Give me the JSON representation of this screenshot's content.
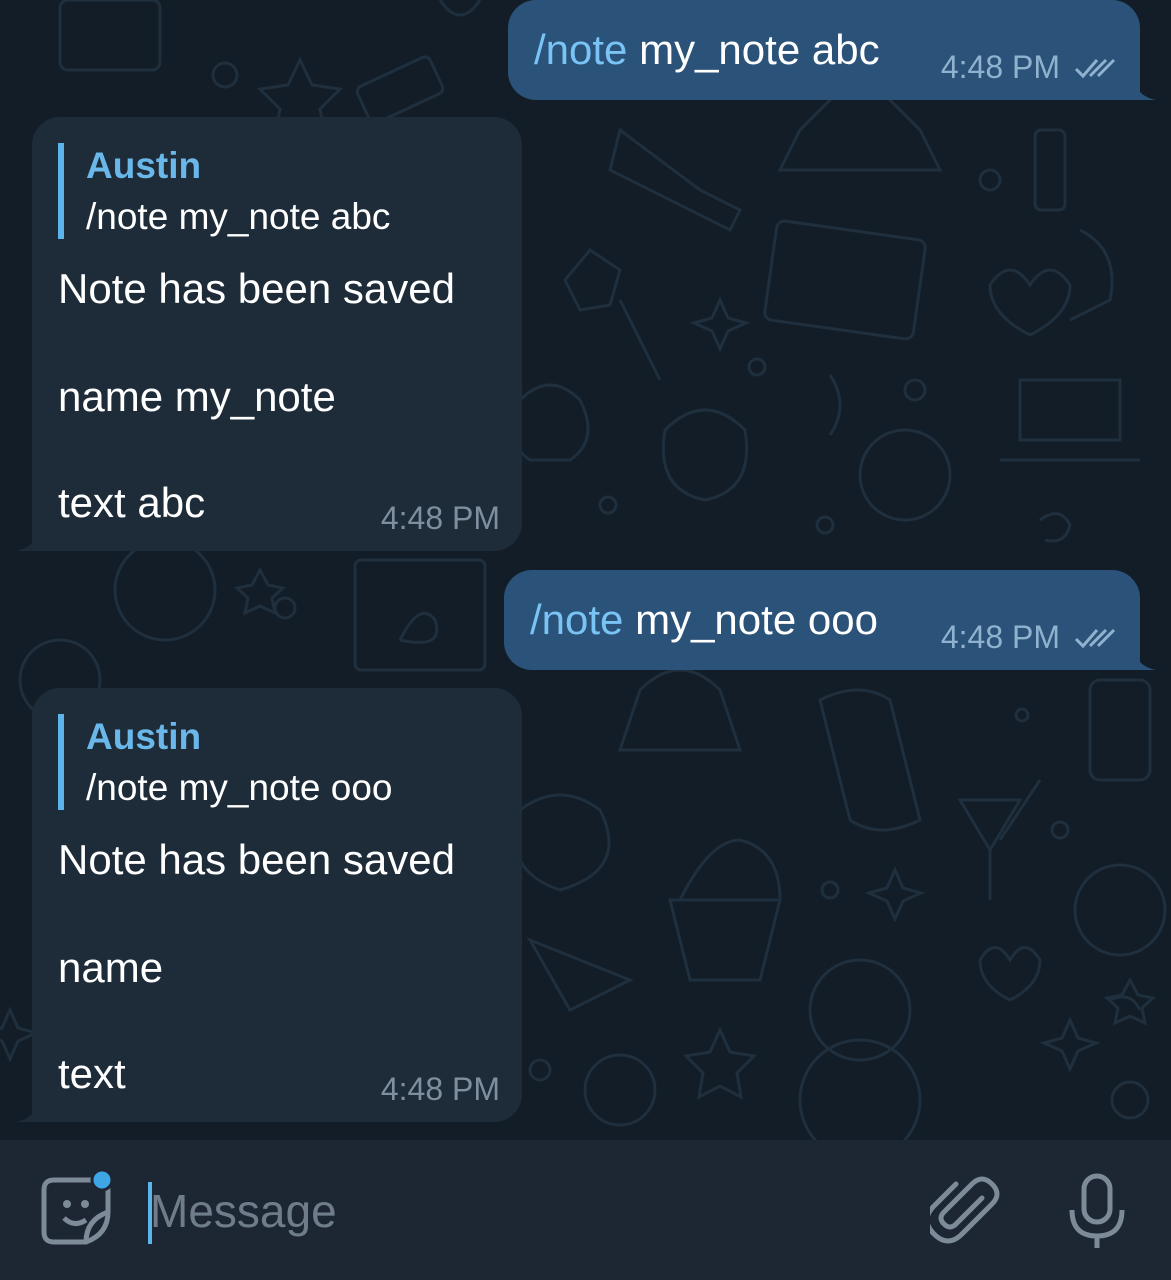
{
  "messages": [
    {
      "direction": "outgoing",
      "command": "/note",
      "args": " my_note abc",
      "time": "4:48 PM",
      "status_icon": "double-check-icon"
    },
    {
      "direction": "incoming",
      "reply_to": {
        "sender": "Austin",
        "text": "/note my_note abc"
      },
      "lines": [
        "Note has been saved",
        "name my_note",
        "text abc"
      ],
      "time": "4:48 PM"
    },
    {
      "direction": "outgoing",
      "command": "/note",
      "args": " my_note ooo",
      "time": "4:48 PM",
      "status_icon": "double-check-icon"
    },
    {
      "direction": "incoming",
      "reply_to": {
        "sender": "Austin",
        "text": "/note my_note ooo"
      },
      "lines": [
        "Note has been saved",
        "name",
        "text"
      ],
      "time": "4:48 PM"
    }
  ],
  "composer": {
    "placeholder": "Message",
    "value": "",
    "icons": {
      "sticker": "sticker-icon",
      "attach": "paperclip-icon",
      "voice": "microphone-icon"
    }
  },
  "colors": {
    "background": "#121d28",
    "outgoing_bubble": "#2b5278",
    "incoming_bubble": "#1e2c3a",
    "accent": "#5bb4ea",
    "command_link": "#79c4f5",
    "composer_bg": "#1d2733"
  }
}
